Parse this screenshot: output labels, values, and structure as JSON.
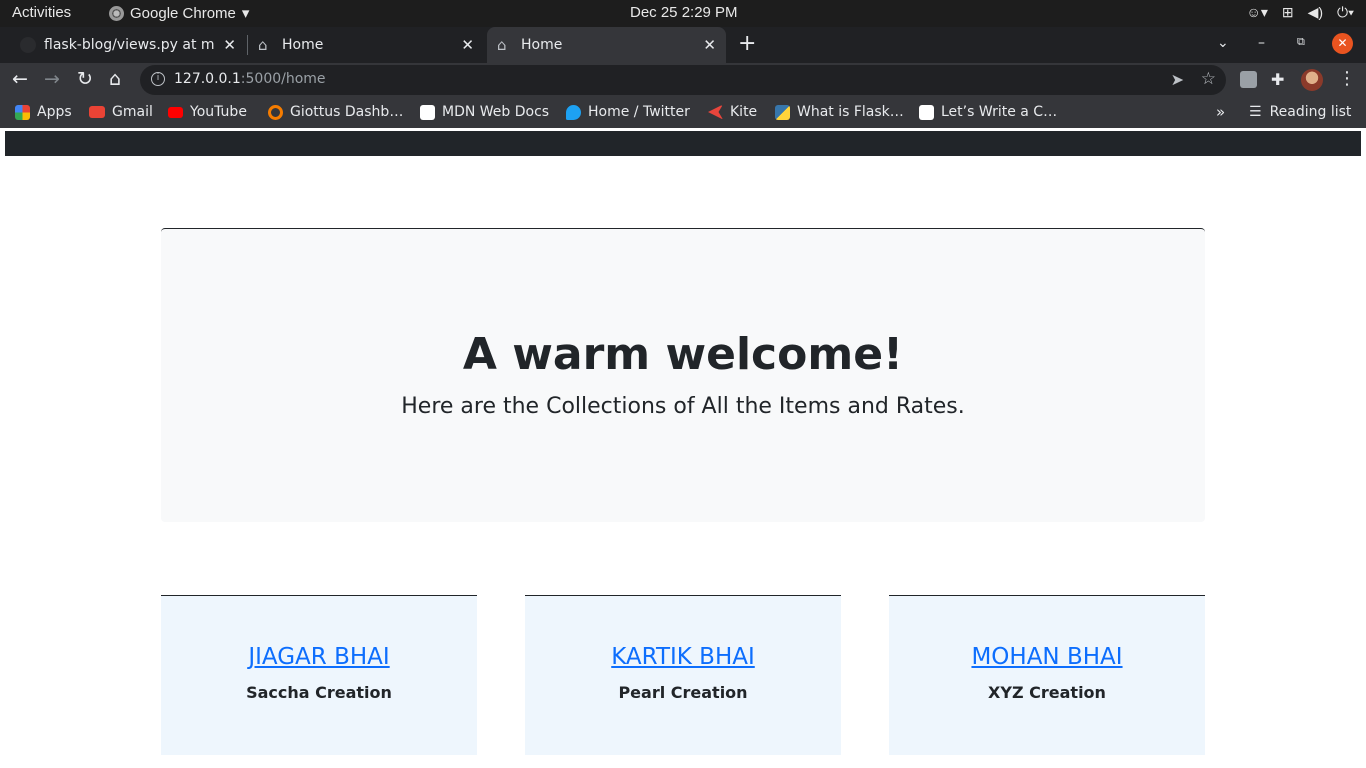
{
  "system_bar": {
    "activities": "Activities",
    "app_name": "Google Chrome",
    "clock": "Dec 25  2:29 PM"
  },
  "tabs": [
    {
      "title": "flask-blog/views.py at ma",
      "active": false
    },
    {
      "title": "Home",
      "active": false
    },
    {
      "title": "Home",
      "active": true
    }
  ],
  "toolbar": {
    "url_host": "127.0.0.1",
    "url_path": ":5000/home"
  },
  "bookmarks": [
    {
      "label": "Apps",
      "icon": "apps-grid-icon",
      "color": "#ea4335"
    },
    {
      "label": "Gmail",
      "icon": "gmail-icon",
      "color": "#ea4335"
    },
    {
      "label": "YouTube",
      "icon": "youtube-icon",
      "color": "#ff0000"
    },
    {
      "label": "Giottus Dashb…",
      "icon": "giottus-icon",
      "color": "#f57c00"
    },
    {
      "label": "MDN Web Docs",
      "icon": "mdn-icon",
      "color": "#ffffff"
    },
    {
      "label": "Home / Twitter",
      "icon": "twitter-icon",
      "color": "#1da1f2"
    },
    {
      "label": "Kite",
      "icon": "kite-icon",
      "color": "#e8453c"
    },
    {
      "label": "What is Flask…",
      "icon": "python-icon",
      "color": "#3776ab"
    },
    {
      "label": "Let’s Write a C…",
      "icon": "medium-icon",
      "color": "#ffffff"
    }
  ],
  "reading_list": "Reading list",
  "page": {
    "heading": "A warm welcome!",
    "subheading": "Here are the Collections of All the Items and Rates.",
    "cards": [
      {
        "name": "JIAGAR BHAI",
        "subtitle": "Saccha Creation"
      },
      {
        "name": "KARTIK BHAI",
        "subtitle": "Pearl Creation"
      },
      {
        "name": "MOHAN BHAI",
        "subtitle": "XYZ Creation"
      }
    ]
  }
}
